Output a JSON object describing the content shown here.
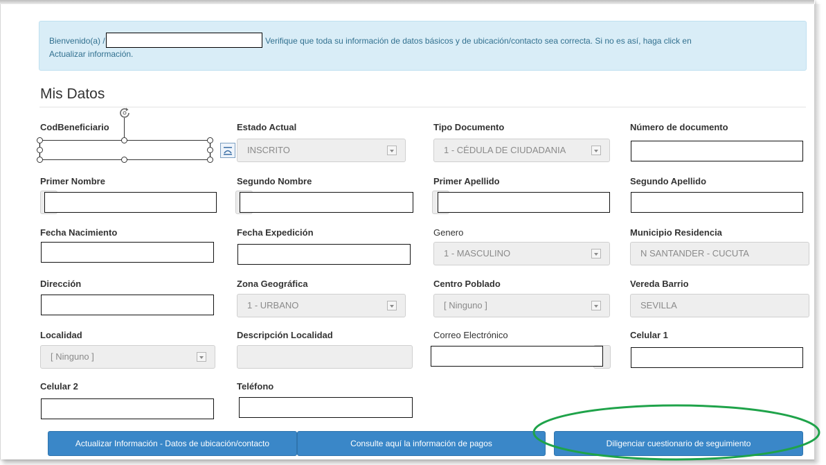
{
  "alert": {
    "greeting": "Bienvenido(a)",
    "name_char": "/",
    "message": "Verifique que toda su información de datos básicos y de ubicación/contacto sea correcta. Si no es así, haga click en",
    "message_line2": "Actualizar información."
  },
  "section_title": "Mis Datos",
  "fields": {
    "cod_beneficiario": {
      "label": "CodBeneficiario",
      "value": ""
    },
    "estado_actual": {
      "label": "Estado Actual",
      "value": "INSCRITO"
    },
    "tipo_documento": {
      "label": "Tipo Documento",
      "value": "1 - CÉDULA DE CIUDADANIA"
    },
    "numero_documento": {
      "label": "Número de documento",
      "value": ""
    },
    "primer_nombre": {
      "label": "Primer Nombre",
      "value": ""
    },
    "segundo_nombre": {
      "label": "Segundo Nombre",
      "value": ""
    },
    "primer_apellido": {
      "label": "Primer Apellido",
      "value": ""
    },
    "segundo_apellido": {
      "label": "Segundo Apellido",
      "value": ""
    },
    "fecha_nacimiento": {
      "label": "Fecha Nacimiento",
      "value": ""
    },
    "fecha_expedicion": {
      "label": "Fecha Expedición",
      "value": ""
    },
    "genero": {
      "label": "Genero",
      "value": "1 - MASCULINO"
    },
    "municipio_residencia": {
      "label": "Municipio Residencia",
      "value": "N SANTANDER - CUCUTA"
    },
    "direccion": {
      "label": "Dirección",
      "value": ""
    },
    "zona_geografica": {
      "label": "Zona Geográfica",
      "value": "1 - URBANO"
    },
    "centro_poblado": {
      "label": "Centro Poblado",
      "value": "[ Ninguno ]"
    },
    "vereda_barrio": {
      "label": "Vereda Barrio",
      "value": "SEVILLA"
    },
    "localidad": {
      "label": "Localidad",
      "value": "[ Ninguno ]"
    },
    "descripcion_localidad": {
      "label": "Descripción Localidad",
      "value": ""
    },
    "correo_electronico": {
      "label": "Correo Electrónico",
      "value": ""
    },
    "celular_1": {
      "label": "Celular 1",
      "value": ""
    },
    "celular_2": {
      "label": "Celular 2",
      "value": ""
    },
    "telefono": {
      "label": "Teléfono",
      "value": ""
    }
  },
  "buttons": {
    "actualizar": "Actualizar Información - Datos de ubicación/contacto",
    "pagos": "Consulte aquí la información de pagos",
    "cuestionario": "Diligenciar cuestionario de seguimiento"
  },
  "colors": {
    "alert_bg": "#d9edf7",
    "alert_text": "#31708f",
    "button": "#3a87c8",
    "highlight_oval": "#1fa34a"
  },
  "icons": {
    "rotate": "rotate-handle-icon",
    "layout": "layout-options-icon",
    "caret": "chevron-down-icon"
  }
}
